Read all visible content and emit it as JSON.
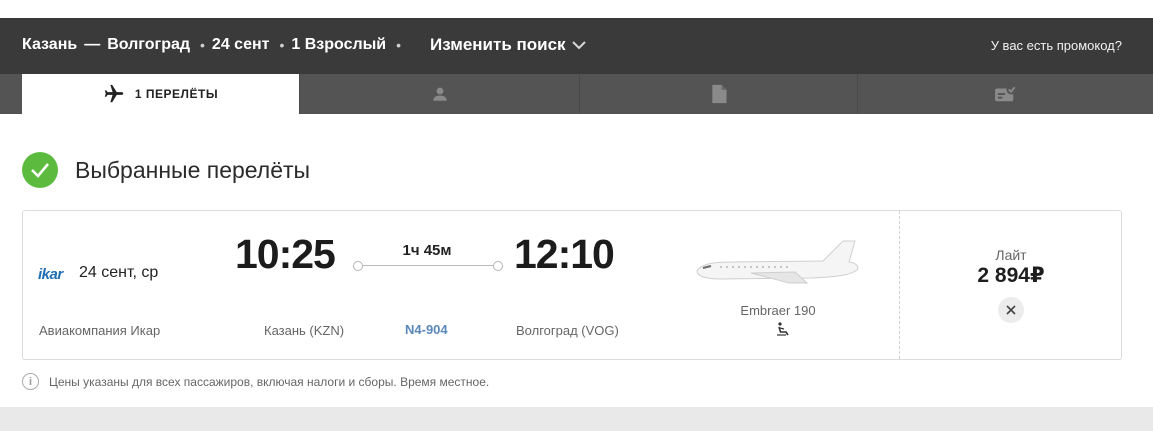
{
  "header": {
    "origin": "Казань",
    "dash": "—",
    "destination": "Волгоград",
    "date": "24 сент",
    "passengers": "1 Взрослый",
    "separator": "•",
    "change_search": "Изменить поиск",
    "promo": "У вас есть промокод?"
  },
  "tabs": [
    {
      "label": "1 ПЕРЕЛЁТЫ",
      "icon": "airplane-icon",
      "active": true
    },
    {
      "label": "",
      "icon": "person-icon",
      "active": false
    },
    {
      "label": "",
      "icon": "document-icon",
      "active": false
    },
    {
      "label": "",
      "icon": "ticket-check-icon",
      "active": false
    }
  ],
  "section": {
    "title": "Выбранные перелёты",
    "icon": "checkmark-circle-icon"
  },
  "flight": {
    "airline_logo": "ikar",
    "date": "24 сент, ср",
    "airline": "Авиакомпания Икар",
    "departure_time": "10:25",
    "arrival_time": "12:10",
    "duration": "1ч 45м",
    "departure_airport": "Казань (KZN)",
    "arrival_airport": "Волгоград (VOG)",
    "flight_number": "N4-904",
    "aircraft": "Embraer 190",
    "amenity_icon": "seat-icon",
    "fare_name": "Лайт",
    "price": "2 894₽",
    "remove_icon": "close-icon"
  },
  "note": {
    "icon": "info-icon",
    "text": "Цены указаны для всех пассажиров, включая налоги и сборы. Время местное."
  },
  "colors": {
    "topbar": "#3a3a3a",
    "tabbar": "#545454",
    "success": "#5cbb3f",
    "link": "#5a88b8",
    "brand": "#1f6fb5"
  }
}
